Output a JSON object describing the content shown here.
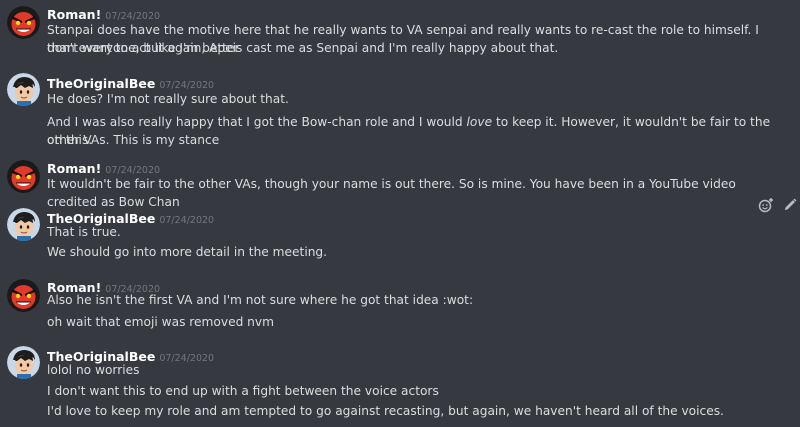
{
  "messages": [
    {
      "author": "Roman!",
      "avatar": "angry-face-avatar",
      "timestamp": "07/24/2020",
      "lines": [
        "Stanpai does have the motive here that he really wants to VA senpai and really wants to re-cast the role to himself. I don't want to act like I'm better",
        "than everyone, but again, Apeis cast me as Senpai and I'm really happy about that."
      ]
    },
    {
      "author": "TheOriginalBee",
      "avatar": "cartoon-boy-avatar",
      "timestamp": "07/24/2020",
      "lines": [
        "He does? I'm not really sure about that.",
        "And I was also really happy that I got the Bow-chan role and I would",
        "love",
        "to keep it. However, it wouldn't be fair to the other VAs. This is my stance",
        "on this."
      ]
    },
    {
      "author": "Roman!",
      "avatar": "angry-face-avatar",
      "timestamp": "07/24/2020",
      "lines": [
        "It wouldn't be fair to the other VAs, though your name is out there. So is mine. You have been in a YouTube video credited as Bow Chan"
      ]
    },
    {
      "author": "TheOriginalBee",
      "avatar": "cartoon-boy-avatar",
      "timestamp": "07/24/2020",
      "lines": [
        "That is true.",
        "We should go into more detail in the meeting."
      ]
    },
    {
      "author": "Roman!",
      "avatar": "angry-face-avatar",
      "timestamp": "07/24/2020",
      "lines": [
        "Also he isn't the first VA and I'm not sure where he got that idea :wot:",
        "oh wait that emoji was removed nvm"
      ]
    },
    {
      "author": "TheOriginalBee",
      "avatar": "cartoon-boy-avatar",
      "timestamp": "07/24/2020",
      "lines": [
        "lolol no worries",
        "I don't want this to end up with a fight between the voice actors",
        "I'd love to keep my role and am tempted to go against recasting, but again, we haven't heard all of the voices."
      ]
    }
  ],
  "toolbar": {
    "add_reaction_icon": "add-reaction-icon",
    "edit_icon": "pencil-icon"
  },
  "colors": {
    "background": "#36393f",
    "text": "#dcddde",
    "username": "#ffffff",
    "timestamp": "#72767d",
    "toolbar_icon": "#b9bbbe"
  }
}
